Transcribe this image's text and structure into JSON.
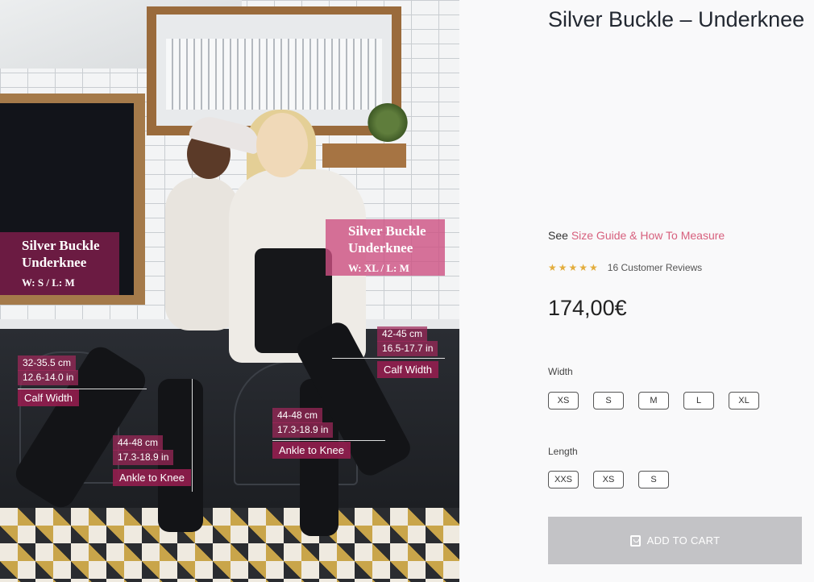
{
  "product": {
    "title": "Silver Buckle – Underknee",
    "price": "174,00€",
    "see_prefix": "See",
    "size_guide_link": "Size Guide & How To Measure",
    "rating": {
      "stars": 5,
      "stars_text": "★★★★★",
      "reviews_text": "16 Customer Reviews"
    },
    "width": {
      "label": "Width",
      "options": [
        "XS",
        "S",
        "M",
        "L",
        "XL"
      ]
    },
    "length": {
      "label": "Length",
      "options": [
        "XXS",
        "XS",
        "S"
      ]
    },
    "add_to_cart": "ADD TO CART",
    "icons": {
      "cart": "shopping-bag-icon",
      "star": "star-icon"
    },
    "colors": {
      "accent_link": "#d7607d",
      "star": "#e3ad3d",
      "cart_button": "#c3c3c6"
    }
  },
  "photo": {
    "left_label": {
      "name_line1": "Silver Buckle",
      "name_line2": "Underknee",
      "size": "W: S / L: M"
    },
    "right_label": {
      "name_line1": "Silver Buckle",
      "name_line2": "Underknee",
      "size": "W: XL / L: M"
    },
    "measurements": {
      "left_calf": {
        "cm": "32-35.5 cm",
        "in": "12.6-14.0 in",
        "label": "Calf Width"
      },
      "left_ankle": {
        "cm": "44-48 cm",
        "in": "17.3-18.9 in",
        "label": "Ankle to Knee"
      },
      "right_calf": {
        "cm": "42-45 cm",
        "in": "16.5-17.7 in",
        "label": "Calf Width"
      },
      "right_ankle": {
        "cm": "44-48 cm",
        "in": "17.3-18.9 in",
        "label": "Ankle to Knee"
      }
    }
  }
}
